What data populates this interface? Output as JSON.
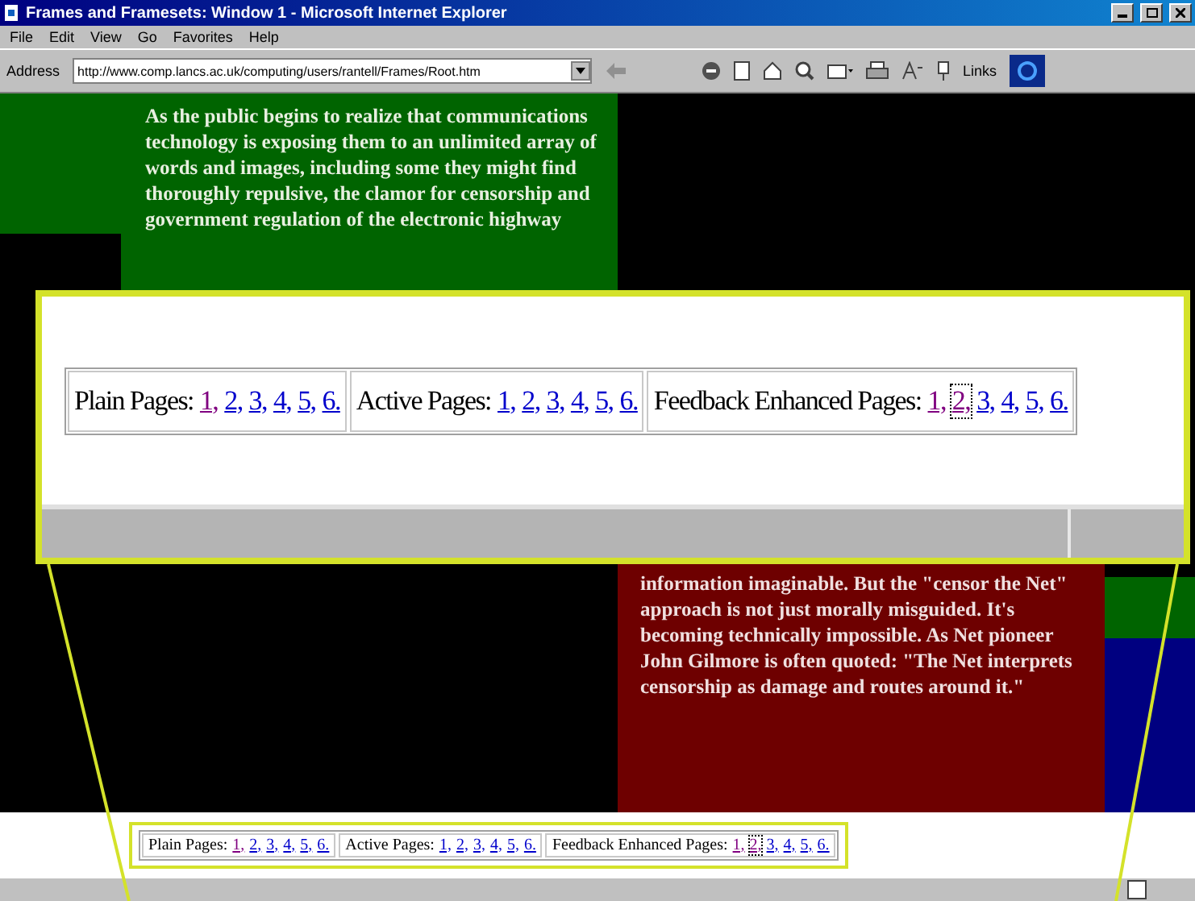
{
  "window": {
    "title": "Frames and Framesets: Window 1 - Microsoft Internet Explorer"
  },
  "menu": [
    "File",
    "Edit",
    "View",
    "Go",
    "Favorites",
    "Help"
  ],
  "address_bar": {
    "label": "Address",
    "value": "http://www.comp.lancs.ac.uk/computing/users/rantell/Frames/Root.htm"
  },
  "links_label": "Links",
  "frames": {
    "green_text": "As the public begins to realize that communications technology is exposing them to an unlimited array of words and images, including some they might find thoroughly repulsive, the clamor for censorship and government regulation of the electronic highway",
    "red_text": "information imaginable. But the \"censor the Net\" approach is not just morally misguided. It's becoming technically impossible. As Net pioneer John Gilmore is often quoted: \"The Net interprets censorship as damage and routes around it.\""
  },
  "magnified_navigation": [
    {
      "label": "Plain Pages:",
      "links": [
        {
          "text": "1,",
          "visited": true,
          "focused": false
        },
        {
          "text": "2,",
          "visited": false,
          "focused": false
        },
        {
          "text": "3,",
          "visited": false,
          "focused": false
        },
        {
          "text": "4,",
          "visited": false,
          "focused": false
        },
        {
          "text": "5,",
          "visited": false,
          "focused": false
        },
        {
          "text": "6.",
          "visited": false,
          "focused": false
        }
      ]
    },
    {
      "label": "Active Pages:",
      "links": [
        {
          "text": "1,",
          "visited": false,
          "focused": false
        },
        {
          "text": "2,",
          "visited": false,
          "focused": false
        },
        {
          "text": "3,",
          "visited": false,
          "focused": false
        },
        {
          "text": "4,",
          "visited": false,
          "focused": false
        },
        {
          "text": "5,",
          "visited": false,
          "focused": false
        },
        {
          "text": "6.",
          "visited": false,
          "focused": false
        }
      ]
    },
    {
      "label": "Feedback Enhanced Pages:",
      "links": [
        {
          "text": "1,",
          "visited": true,
          "focused": false
        },
        {
          "text": "2,",
          "visited": true,
          "focused": true
        },
        {
          "text": "3,",
          "visited": false,
          "focused": false
        },
        {
          "text": "4,",
          "visited": false,
          "focused": false
        },
        {
          "text": "5,",
          "visited": false,
          "focused": false
        },
        {
          "text": "6.",
          "visited": false,
          "focused": false
        }
      ]
    }
  ],
  "navigation": [
    {
      "label": "Plain Pages:",
      "links": [
        {
          "text": "1,",
          "visited": true,
          "focused": false
        },
        {
          "text": "2,",
          "visited": false,
          "focused": false
        },
        {
          "text": "3,",
          "visited": false,
          "focused": false
        },
        {
          "text": "4,",
          "visited": false,
          "focused": false
        },
        {
          "text": "5,",
          "visited": false,
          "focused": false
        },
        {
          "text": "6.",
          "visited": false,
          "focused": false
        }
      ]
    },
    {
      "label": "Active Pages:",
      "links": [
        {
          "text": "1,",
          "visited": false,
          "focused": false
        },
        {
          "text": "2,",
          "visited": false,
          "focused": false
        },
        {
          "text": "3,",
          "visited": false,
          "focused": false
        },
        {
          "text": "4,",
          "visited": false,
          "focused": false
        },
        {
          "text": "5,",
          "visited": false,
          "focused": false
        },
        {
          "text": "6.",
          "visited": false,
          "focused": false
        }
      ]
    },
    {
      "label": "Feedback Enhanced Pages:",
      "links": [
        {
          "text": "1,",
          "visited": true,
          "focused": false
        },
        {
          "text": "2,",
          "visited": true,
          "focused": true
        },
        {
          "text": "3,",
          "visited": false,
          "focused": false
        },
        {
          "text": "4,",
          "visited": false,
          "focused": false
        },
        {
          "text": "5,",
          "visited": false,
          "focused": false
        },
        {
          "text": "6.",
          "visited": false,
          "focused": false
        }
      ]
    }
  ]
}
